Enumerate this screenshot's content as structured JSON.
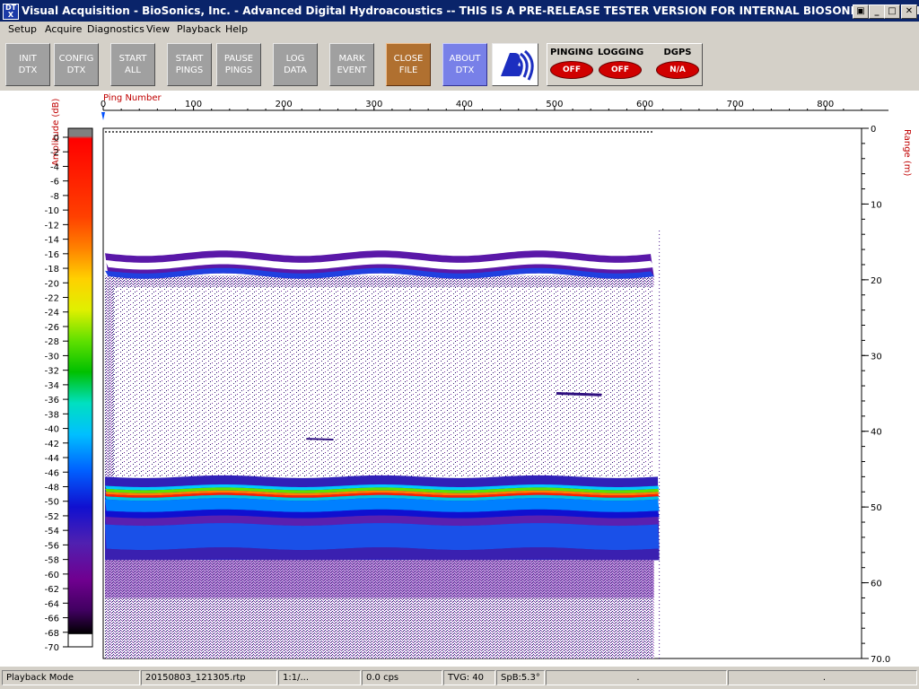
{
  "window": {
    "title": "Visual Acquisition  -  BioSonics, Inc.  -  Advanced Digital Hydroacoustics  -- THIS IS A PRE-RELEASE TESTER VERSION FOR INTERNAL BIOSONICS USE ONLY",
    "icon_text": [
      "DT",
      "X"
    ],
    "controls": [
      "restore",
      "minimize",
      "maximize",
      "close"
    ]
  },
  "menu": [
    "Setup",
    "Acquire",
    "Diagnostics",
    "View",
    "Playback",
    "Help"
  ],
  "toolbar": {
    "buttons": [
      {
        "lines": [
          "INIT",
          "DTX"
        ]
      },
      {
        "lines": [
          "CONFIG",
          "DTX"
        ]
      },
      {
        "lines": [
          "START",
          "ALL"
        ]
      },
      {
        "lines": [
          "START",
          "PINGS"
        ]
      },
      {
        "lines": [
          "PAUSE",
          "PINGS"
        ]
      },
      {
        "lines": [
          "LOG",
          "DATA"
        ]
      },
      {
        "lines": [
          "MARK",
          "EVENT"
        ]
      },
      {
        "lines": [
          "CLOSE",
          "FILE"
        ]
      },
      {
        "lines": [
          "ABOUT",
          "DTX"
        ]
      }
    ],
    "indicators": [
      {
        "label": "PINGING",
        "state": "OFF"
      },
      {
        "label": "LOGGING",
        "state": "OFF"
      },
      {
        "label": "DGPS",
        "state": "N/A"
      }
    ],
    "colors": {
      "button_gray": "#a0a0a0",
      "close_orange": "#b07030",
      "about_blue": "#7880e8",
      "lamp_red": "#d00000"
    }
  },
  "chart_data": {
    "type": "heatmap",
    "title": "",
    "top_axis_label": "Ping Number",
    "x_ticks": [
      0,
      100,
      200,
      300,
      400,
      500,
      600,
      700,
      800
    ],
    "xlim": [
      0,
      840
    ],
    "right_axis_label": "Range (m)",
    "y_ticks": [
      "0",
      "10",
      "20",
      "30",
      "40",
      "50",
      "60",
      "70.0"
    ],
    "ylim": [
      0,
      70
    ],
    "data_extent_pings": [
      0,
      610
    ],
    "colorbar_label": "Amplitude (dB)",
    "colorbar_ticks": [
      "0",
      "-2",
      "-4",
      "-6",
      "-8",
      "-10",
      "-12",
      "-14",
      "-16",
      "-18",
      "-20",
      "-22",
      "-24",
      "-26",
      "-28",
      "-30",
      "-32",
      "-34",
      "-36",
      "-38",
      "-40",
      "-42",
      "-44",
      "-46",
      "-48",
      "-50",
      "-52",
      "-54",
      "-56",
      "-58",
      "-60",
      "-62",
      "-64",
      "-66",
      "-68",
      "-70"
    ],
    "colorbar_range": [
      0,
      -70
    ],
    "layers": [
      {
        "feature": "surface_band",
        "range_m": [
          16.5,
          19.5
        ]
      },
      {
        "feature": "scattered_targets",
        "range_m": [
          19.5,
          46
        ]
      },
      {
        "feature": "bottom_return",
        "range_m": [
          46,
          57
        ]
      },
      {
        "feature": "sub_bottom",
        "range_m": [
          57,
          70
        ]
      }
    ],
    "legend": "none"
  },
  "statusbar": [
    "Playback Mode",
    "20150803_121305.rtp",
    "1:1/...",
    "0.0 cps",
    "TVG: 40",
    "SpB:5.3°",
    ".",
    "."
  ]
}
